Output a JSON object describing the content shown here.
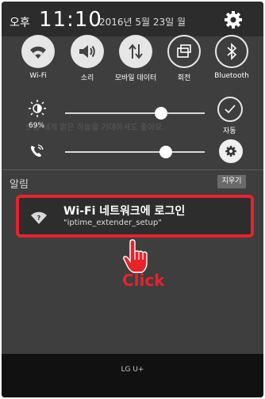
{
  "status_bar": {
    "ampm": "오후",
    "time": "11:10",
    "date": "2016년 5월 23일 월"
  },
  "quick_settings": [
    {
      "label": "Wi-Fi",
      "icon": "wifi-icon",
      "state": "on"
    },
    {
      "label": "소리",
      "icon": "speaker-icon",
      "state": "on"
    },
    {
      "label": "모바일 데이터",
      "icon": "data-arrows-icon",
      "state": "on"
    },
    {
      "label": "회전",
      "icon": "rotate-icon",
      "state": "off"
    },
    {
      "label": "Bluetooth",
      "icon": "bluetooth-icon",
      "state": "off"
    }
  ],
  "brightness": {
    "percent_label": "69%",
    "level": 0.69,
    "auto_label": "자동"
  },
  "volume": {
    "level": 0.72
  },
  "background_text": "오늘 내게 맑은 하늘을 기대하셔도 좋아요.",
  "alerts": {
    "heading": "알림",
    "clear_label": "지우기"
  },
  "notification": {
    "title": "Wi-Fi 네트워크에 로그인",
    "subtitle": "\"iptime_extender_setup\""
  },
  "annotation": {
    "text": "Click",
    "color": "#e8232b"
  },
  "carrier": "LG U+"
}
